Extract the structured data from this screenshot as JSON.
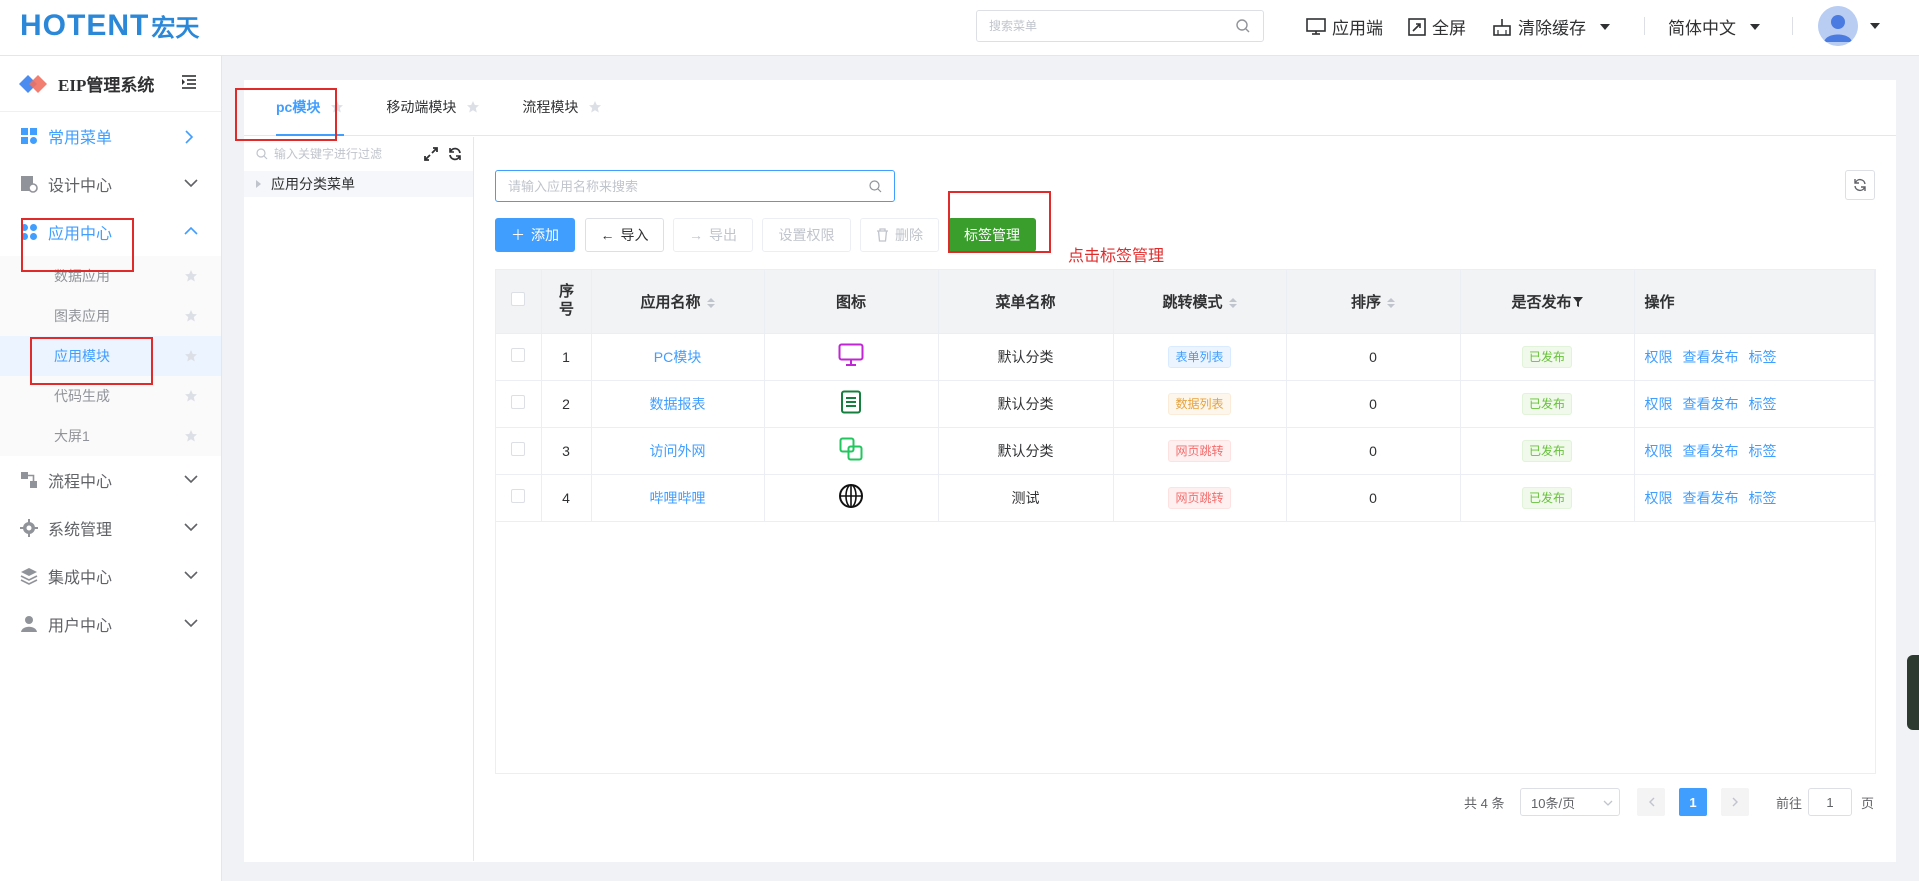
{
  "header": {
    "brand": "HOTENT",
    "brand_cn": "宏天",
    "search_placeholder": "搜索菜单",
    "tools": {
      "app_end": "应用端",
      "fullscreen": "全屏",
      "clear_cache": "清除缓存",
      "language": "简体中文"
    }
  },
  "sidebar": {
    "title": "EIP管理系统",
    "menu": [
      {
        "label": "常用菜单"
      },
      {
        "label": "设计中心"
      },
      {
        "label": "应用中心"
      },
      {
        "label": "流程中心"
      },
      {
        "label": "系统管理"
      },
      {
        "label": "集成中心"
      },
      {
        "label": "用户中心"
      }
    ],
    "app_center_items": [
      {
        "label": "数据应用"
      },
      {
        "label": "图表应用"
      },
      {
        "label": "应用模块"
      },
      {
        "label": "代码生成"
      },
      {
        "label": "大屏1"
      }
    ]
  },
  "tabs": [
    {
      "label": "pc模块"
    },
    {
      "label": "移动端模块"
    },
    {
      "label": "流程模块"
    }
  ],
  "tree": {
    "filter_placeholder": "输入关键字进行过滤",
    "root": "应用分类菜单"
  },
  "search": {
    "placeholder": "请输入应用名称来搜索"
  },
  "toolbar": {
    "add": "添加",
    "import": "导入",
    "export": "导出",
    "permission": "设置权限",
    "delete": "删除",
    "tag_manage": "标签管理"
  },
  "annotation": "点击标签管理",
  "table": {
    "headers": {
      "index": "序号",
      "name": "应用名称",
      "icon": "图标",
      "menu": "菜单名称",
      "jump": "跳转模式",
      "sort": "排序",
      "published": "是否发布",
      "ops": "操作"
    },
    "rows": [
      {
        "index": "1",
        "name": "PC模块",
        "icon": "monitor-icon",
        "menu": "默认分类",
        "jump": "表单列表",
        "sort": "0",
        "status": "已发布"
      },
      {
        "index": "2",
        "name": "数据报表",
        "icon": "report-icon",
        "menu": "默认分类",
        "jump": "数据列表",
        "sort": "0",
        "status": "已发布"
      },
      {
        "index": "3",
        "name": "访问外网",
        "icon": "external-link-icon",
        "menu": "默认分类",
        "jump": "网页跳转",
        "sort": "0",
        "status": "已发布"
      },
      {
        "index": "4",
        "name": "哔哩哔哩",
        "icon": "globe-icon",
        "menu": "测试",
        "jump": "网页跳转",
        "sort": "0",
        "status": "已发布"
      }
    ],
    "ops": {
      "permission": "权限",
      "view": "查看发布",
      "tag": "标签"
    }
  },
  "pagination": {
    "total": "共 4 条",
    "page_size": "10条/页",
    "current": "1",
    "goto_label": "前往",
    "goto_value": "1",
    "page_unit": "页"
  },
  "colors": {
    "primary": "#409eff",
    "success": "#3a9e2d",
    "annotation": "#e02b2b"
  }
}
